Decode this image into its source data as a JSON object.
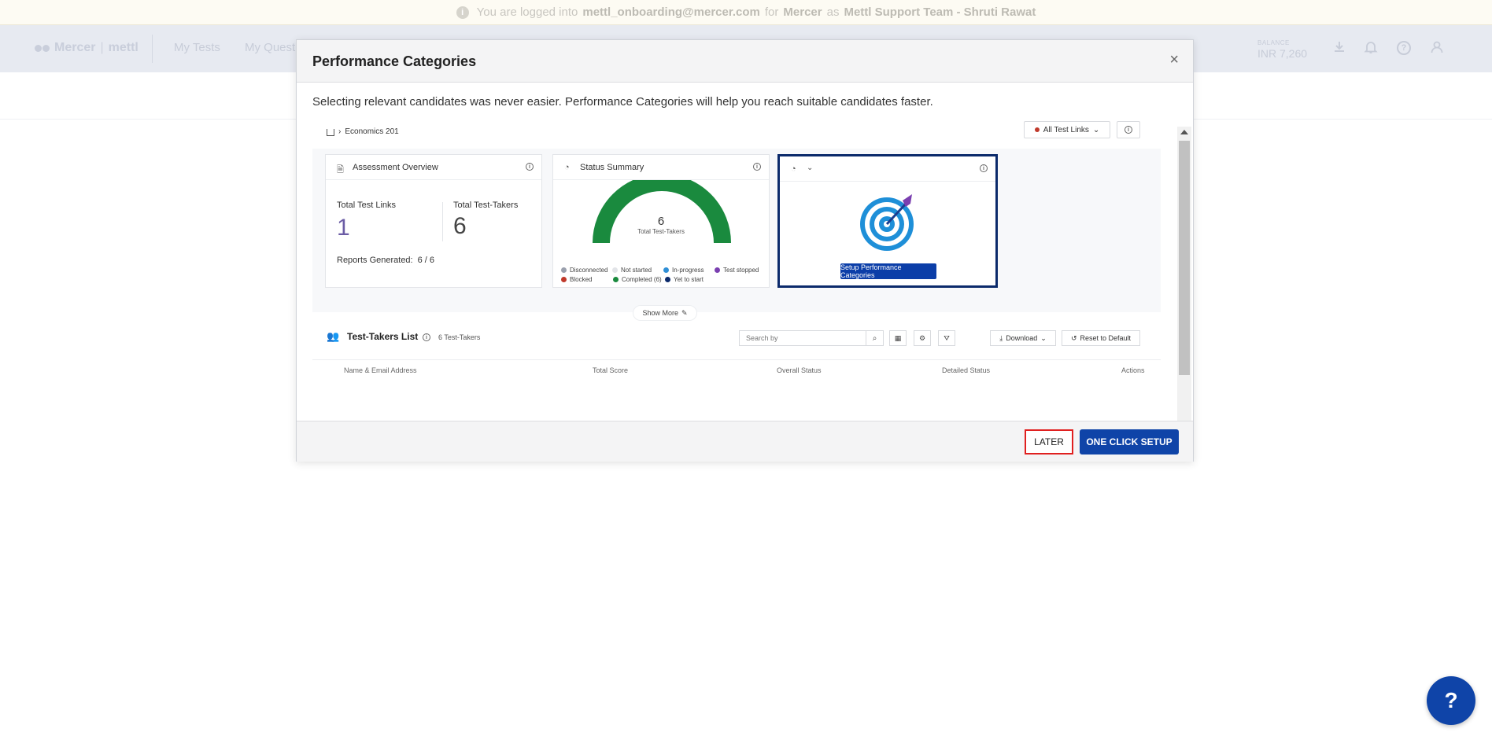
{
  "banner": {
    "prefix": "You are logged into",
    "email": "mettl_onboarding@mercer.com",
    "for": "for",
    "company": "Mercer",
    "as": "as",
    "user": "Mettl Support Team - Shruti Rawat"
  },
  "header": {
    "logo_mercer": "Mercer",
    "logo_mettl": "mettl",
    "nav": [
      "My Tests",
      "My Quest"
    ],
    "balance_label": "BALANCE",
    "balance_value": "INR 7,260"
  },
  "modal": {
    "title": "Performance Categories",
    "close": "×",
    "intro": "Selecting relevant candidates was never easier. Performance Categories will help you reach suitable candidates faster.",
    "preview": {
      "breadcrumb": "Economics 201",
      "all_test_links": "All Test Links",
      "assessment_overview": {
        "title": "Assessment Overview",
        "total_test_links_label": "Total Test Links",
        "total_test_links": "1",
        "total_test_takers_label": "Total Test-Takers",
        "total_test_takers": "6",
        "reports_label": "Reports Generated:",
        "reports_value": "6 / 6"
      },
      "status_summary": {
        "title": "Status Summary",
        "center_value": "6",
        "center_label": "Total Test-Takers",
        "legend": [
          {
            "label": "Disconnected",
            "color": "#9aa0ad"
          },
          {
            "label": "Not started",
            "color": "#e2e4e8"
          },
          {
            "label": "In-progress",
            "color": "#2f8fd6"
          },
          {
            "label": "Test stopped",
            "color": "#7a3fb0"
          },
          {
            "label": "Blocked",
            "color": "#c0392b"
          },
          {
            "label": "Completed (6)",
            "color": "#1a8a3e"
          },
          {
            "label": "Yet to start",
            "color": "#0b2a6b"
          }
        ],
        "completed_fraction": 1
      },
      "setup_button": "Setup Performance Categories",
      "show_more": "Show More",
      "test_takers": {
        "title": "Test-Takers List",
        "count": "6 Test-Takers",
        "search_placeholder": "Search by",
        "download": "Download",
        "reset": "Reset to Default",
        "columns": [
          "Name & Email Address",
          "Total Score",
          "Overall Status",
          "Detailed Status",
          "Actions"
        ]
      }
    },
    "footer": {
      "later": "LATER",
      "one_click_setup": "ONE CLICK SETUP"
    }
  },
  "help": "?",
  "colors": {
    "primary": "#0f44a8",
    "highlight_border": "#0b2a6b",
    "later_border": "#e02020",
    "gauge_green": "#1a8a3e"
  }
}
